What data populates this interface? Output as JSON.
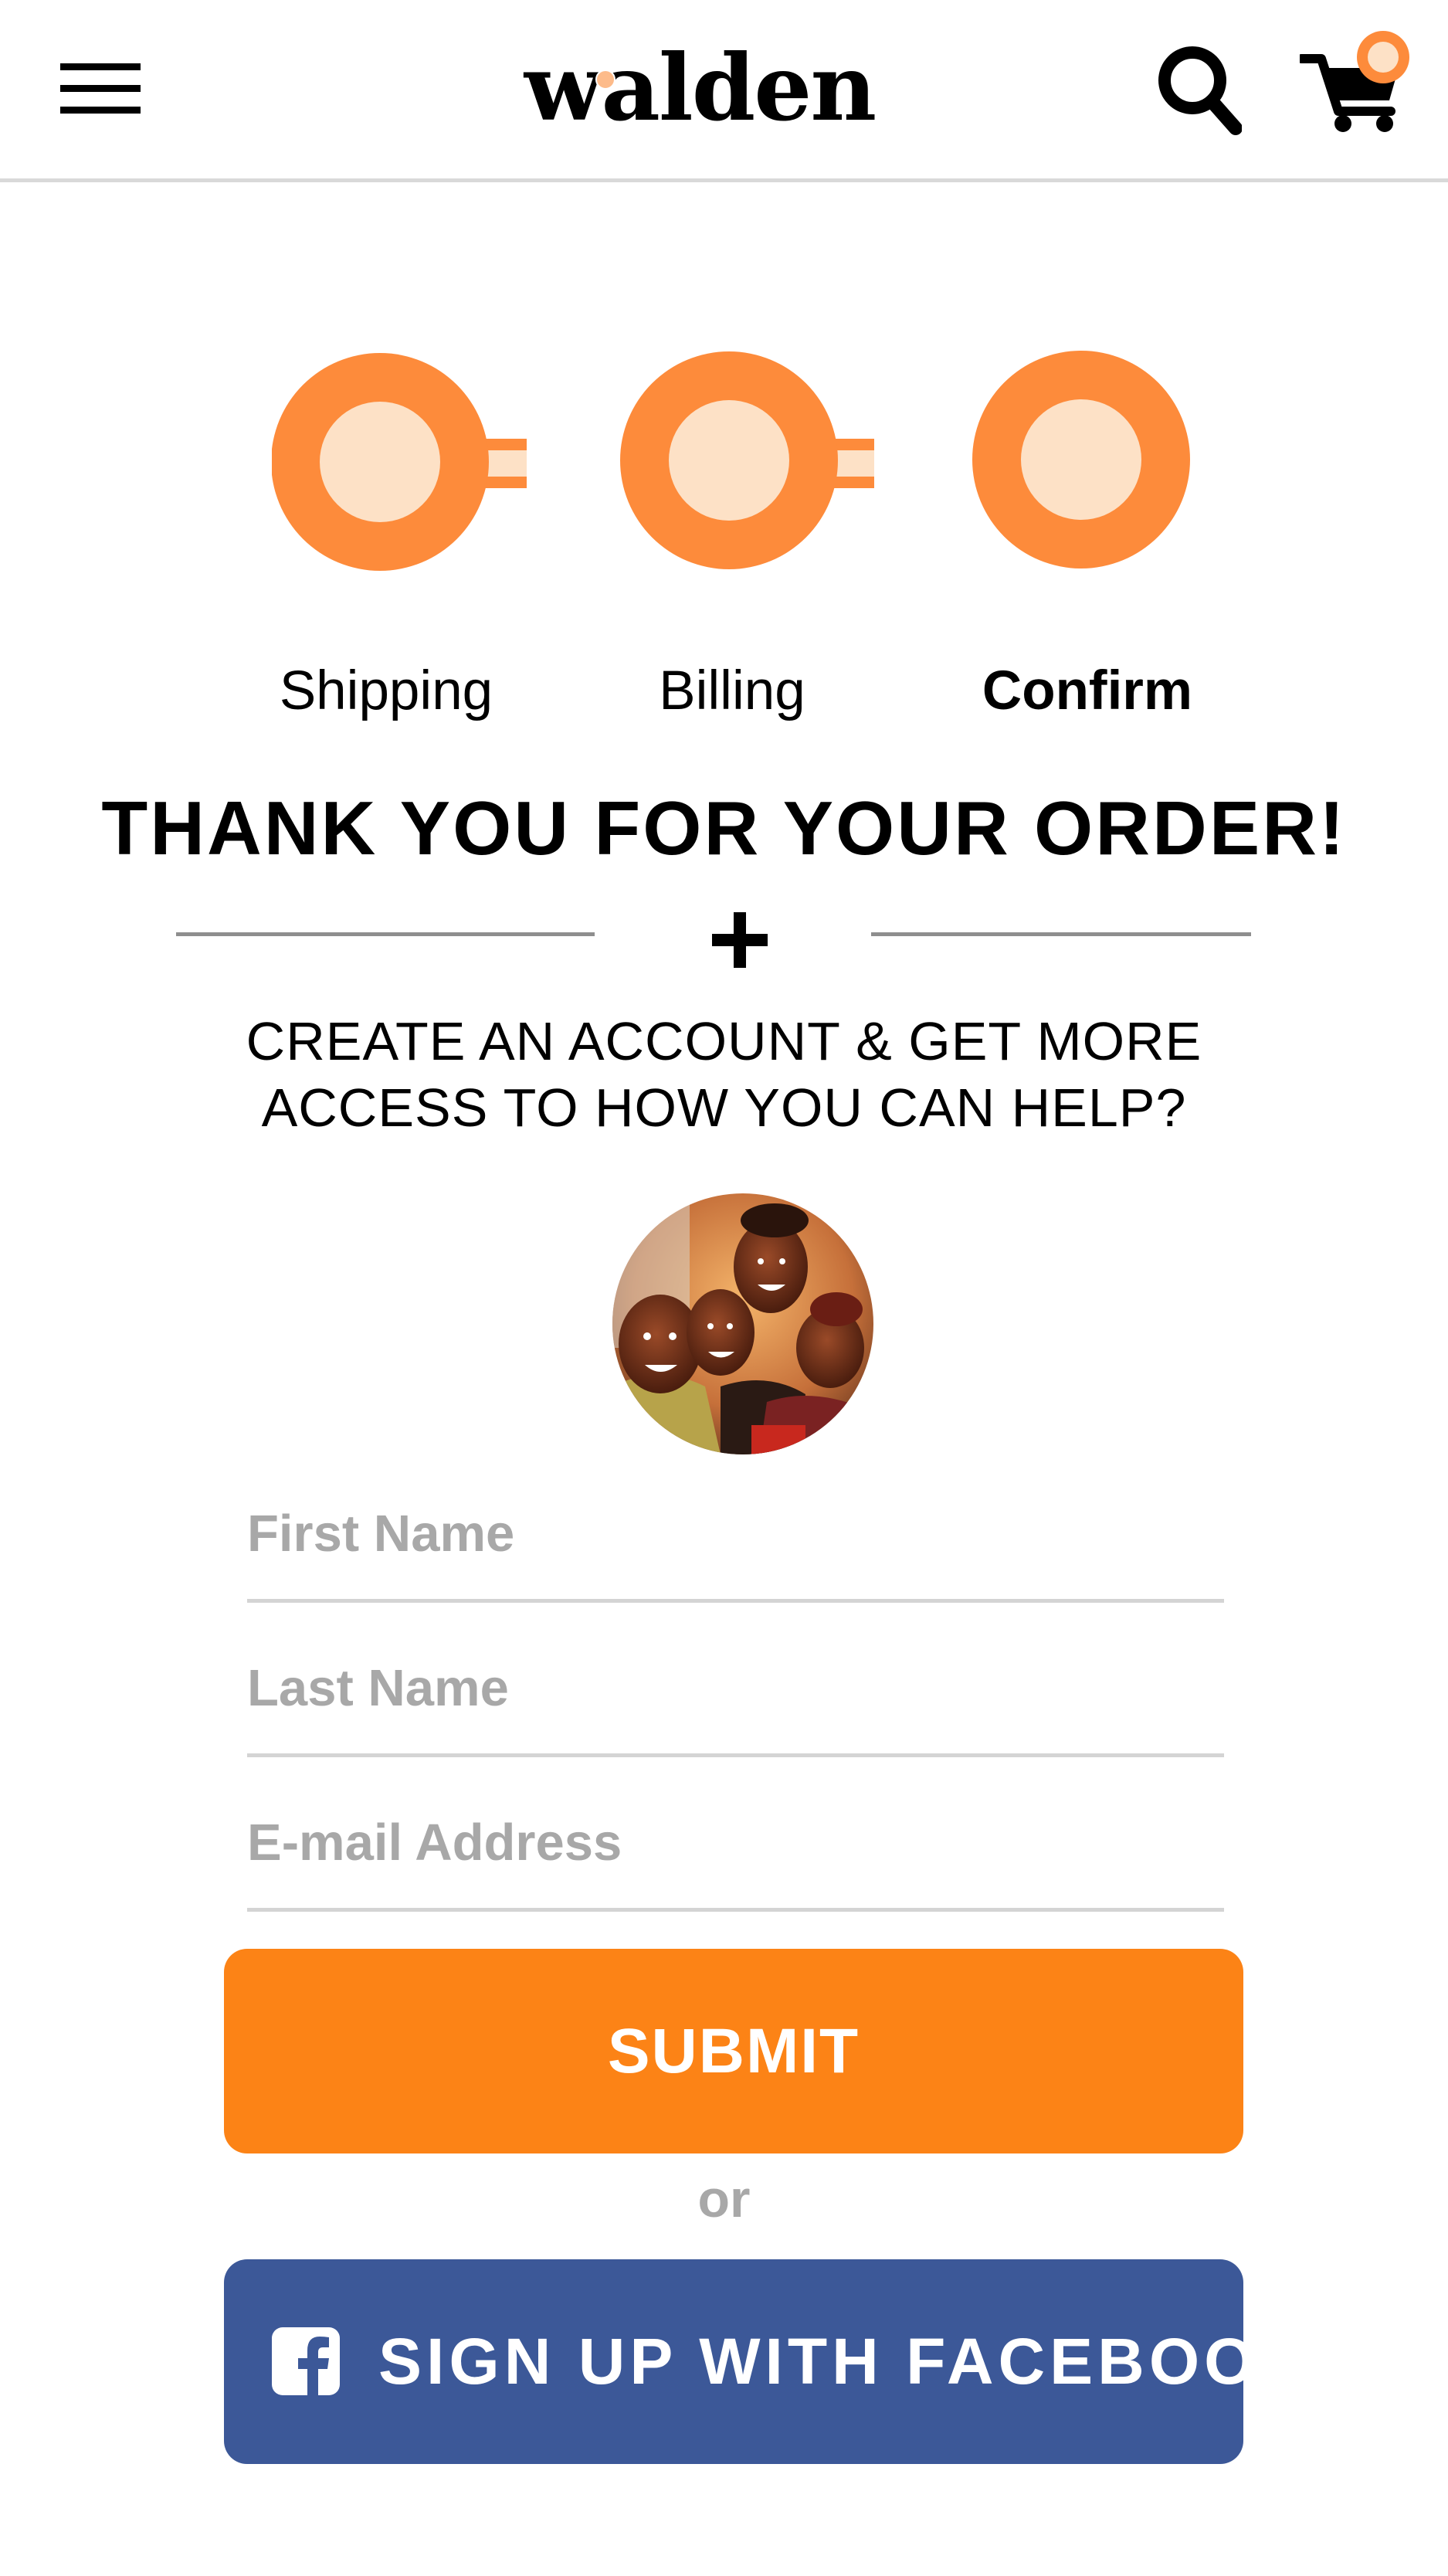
{
  "header": {
    "logo_text": "walden",
    "menu_icon": "hamburger-menu-icon",
    "search_icon": "search-icon",
    "cart_icon": "shopping-cart-icon",
    "accent_color": "#fd8b3b"
  },
  "steps": [
    {
      "label": "Shipping",
      "active": false
    },
    {
      "label": "Billing",
      "active": false
    },
    {
      "label": "Confirm",
      "active": true
    }
  ],
  "thank_you": "THANK YOU FOR YOUR ORDER!",
  "cta": {
    "line1": "CREATE AN ACCOUNT & GET MORE",
    "line2": "ACCESS TO HOW YOU CAN HELP?"
  },
  "form": {
    "first_name": {
      "placeholder": "First Name",
      "value": ""
    },
    "last_name": {
      "placeholder": "Last Name",
      "value": ""
    },
    "email": {
      "placeholder": "E-mail Address",
      "value": ""
    }
  },
  "buttons": {
    "submit": "SUBMIT",
    "or": "or",
    "facebook": "SIGN UP WITH FACEBOOK"
  },
  "colors": {
    "orange": "#fc8316",
    "step_orange": "#fd8b3b",
    "step_fill": "#fde1c6",
    "facebook_blue": "#3c5898"
  }
}
